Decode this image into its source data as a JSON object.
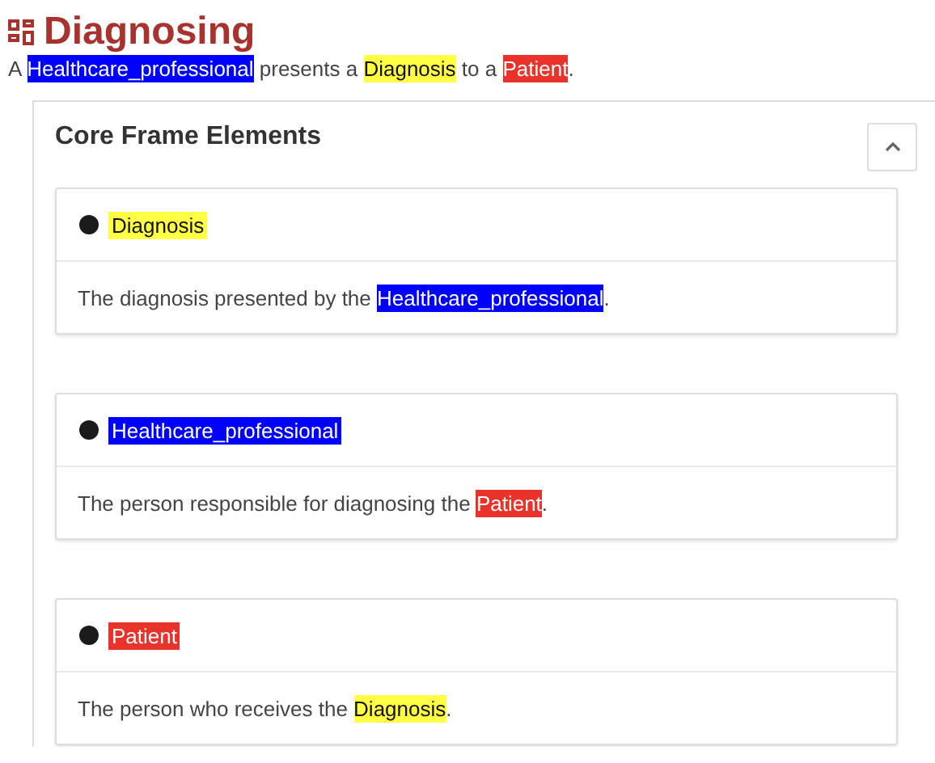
{
  "frame": {
    "title": "Diagnosing",
    "definition": [
      {
        "text": "A "
      },
      {
        "text": "Healthcare_professional",
        "color": "#0000ff"
      },
      {
        "text": " presents a "
      },
      {
        "text": "Diagnosis",
        "color": "#ffff44"
      },
      {
        "text": " to a "
      },
      {
        "text": "Patient",
        "color": "#e8322a"
      },
      {
        "text": "."
      }
    ]
  },
  "panel": {
    "title": "Core Frame Elements",
    "expanded": true,
    "elements": [
      {
        "name": "Diagnosis",
        "color": "#ffff44",
        "description": [
          {
            "text": "The diagnosis presented by the "
          },
          {
            "text": "Healthcare_professional",
            "color": "#0000ff"
          },
          {
            "text": "."
          }
        ]
      },
      {
        "name": "Healthcare_professional",
        "color": "#0000ff",
        "description": [
          {
            "text": "The person responsible for diagnosing the "
          },
          {
            "text": "Patient",
            "color": "#e8322a"
          },
          {
            "text": "."
          }
        ]
      },
      {
        "name": "Patient",
        "color": "#e8322a",
        "description": [
          {
            "text": "The person who receives the "
          },
          {
            "text": "Diagnosis",
            "color": "#ffff44"
          },
          {
            "text": "."
          }
        ]
      }
    ]
  }
}
